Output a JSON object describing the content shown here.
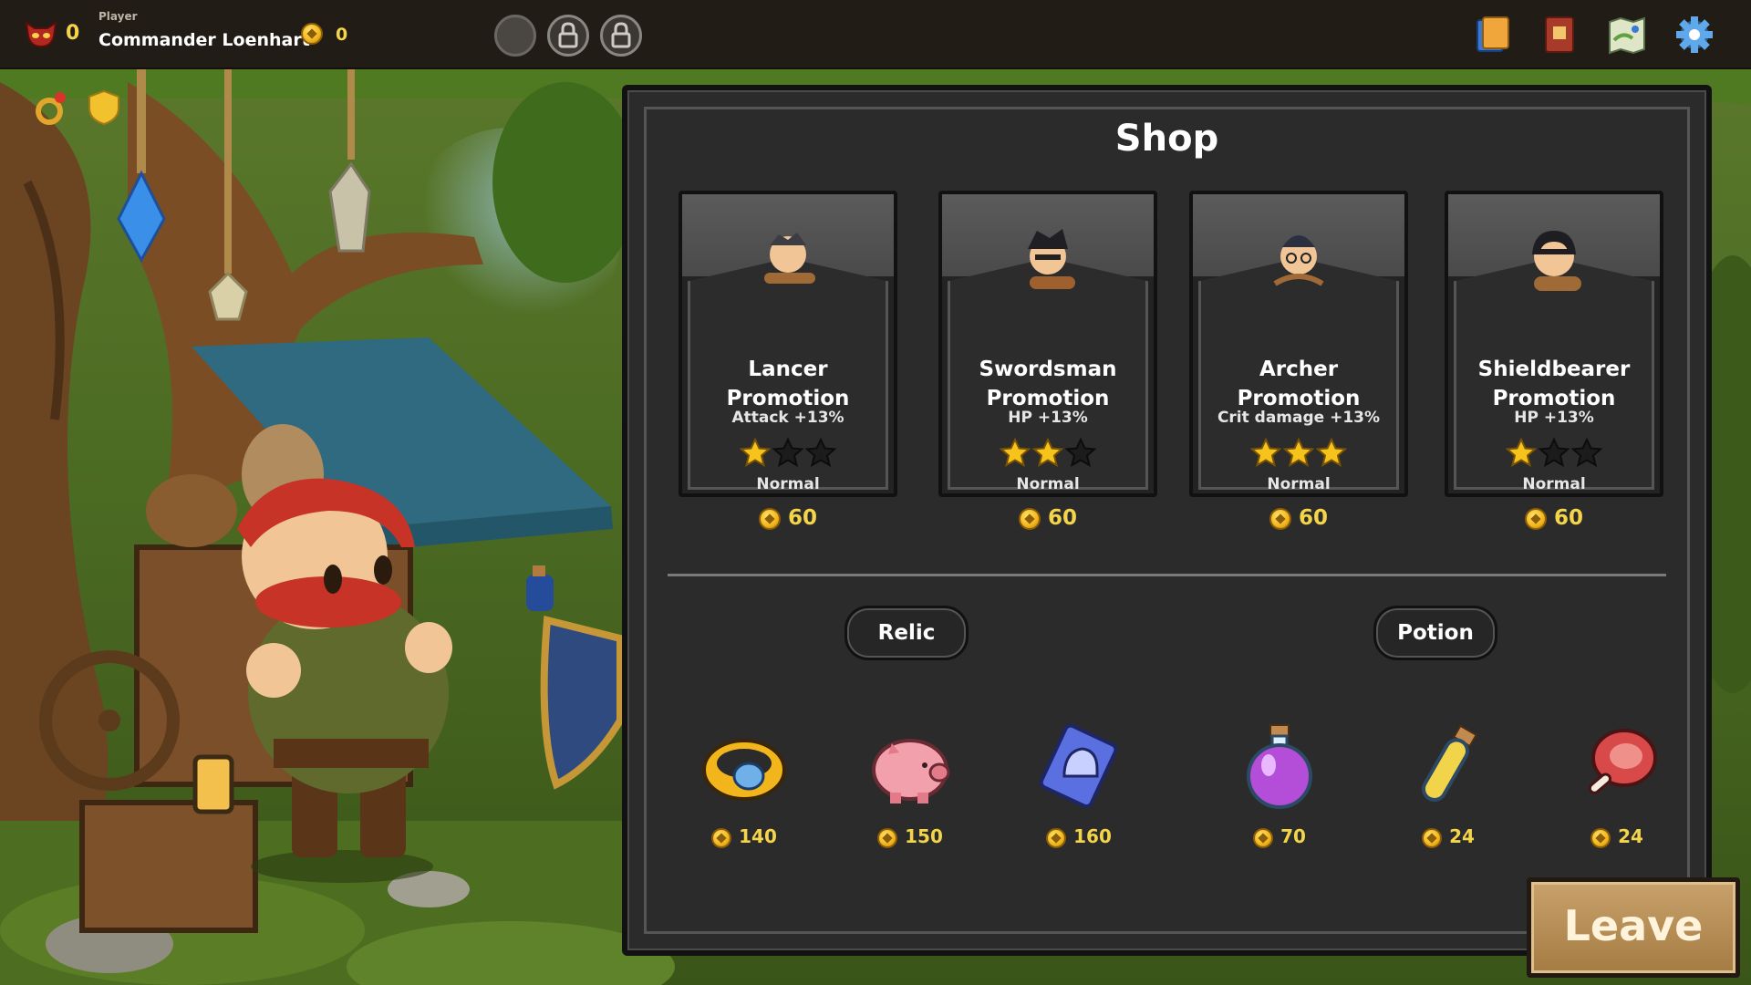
{
  "topbar": {
    "troop_count": "0",
    "player_label": "Player",
    "player_name": "Commander Loenhart",
    "gold": "0"
  },
  "shop": {
    "title": "Shop",
    "cards": [
      {
        "name": "Lancer Promotion",
        "effect": "Attack +13%",
        "stars": 1,
        "rarity": "Normal",
        "price": "60"
      },
      {
        "name": "Swordsman Promotion",
        "effect": "HP +13%",
        "stars": 2,
        "rarity": "Normal",
        "price": "60"
      },
      {
        "name": "Archer Promotion",
        "effect": "Crit damage +13%",
        "stars": 3,
        "rarity": "Normal",
        "price": "60"
      },
      {
        "name": "Shieldbearer Promotion",
        "effect": "HP +13%",
        "stars": 1,
        "rarity": "Normal",
        "price": "60"
      }
    ],
    "categories": {
      "relic": "Relic",
      "potion": "Potion"
    },
    "items": [
      {
        "icon": "golden-ring-icon",
        "price": "140"
      },
      {
        "icon": "piggy-bank-icon",
        "price": "150"
      },
      {
        "icon": "helmet-card-icon",
        "price": "160"
      },
      {
        "icon": "purple-potion-icon",
        "price": "70"
      },
      {
        "icon": "yellow-vial-icon",
        "price": "24"
      },
      {
        "icon": "meat-icon",
        "price": "24"
      }
    ]
  },
  "leave_label": "Leave",
  "colors": {
    "gold_text": "#f4d54a",
    "panel": "#2b2b2b",
    "leave_button": "#b48c55"
  }
}
